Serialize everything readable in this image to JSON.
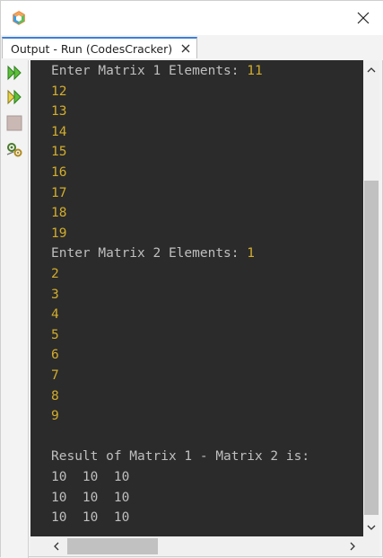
{
  "window": {
    "tab_title": "Output - Run (CodesCracker)"
  },
  "toolbar": {
    "icons": [
      "rerun-icon",
      "rerun-with-options-icon",
      "stop-icon",
      "settings-icon"
    ]
  },
  "console": {
    "lines": [
      {
        "prompt": "Enter Matrix 1 Elements: ",
        "input": "11"
      },
      {
        "prompt": "",
        "input": "12"
      },
      {
        "prompt": "",
        "input": "13"
      },
      {
        "prompt": "",
        "input": "14"
      },
      {
        "prompt": "",
        "input": "15"
      },
      {
        "prompt": "",
        "input": "16"
      },
      {
        "prompt": "",
        "input": "17"
      },
      {
        "prompt": "",
        "input": "18"
      },
      {
        "prompt": "",
        "input": "19"
      },
      {
        "prompt": "Enter Matrix 2 Elements: ",
        "input": "1"
      },
      {
        "prompt": "",
        "input": "2"
      },
      {
        "prompt": "",
        "input": "3"
      },
      {
        "prompt": "",
        "input": "4"
      },
      {
        "prompt": "",
        "input": "5"
      },
      {
        "prompt": "",
        "input": "6"
      },
      {
        "prompt": "",
        "input": "7"
      },
      {
        "prompt": "",
        "input": "8"
      },
      {
        "prompt": "",
        "input": "9"
      },
      {
        "prompt": "",
        "input": ""
      },
      {
        "prompt": "Result of Matrix 1 - Matrix 2 is:",
        "input": ""
      },
      {
        "prompt": "10  10  10",
        "input": ""
      },
      {
        "prompt": "10  10  10",
        "input": ""
      },
      {
        "prompt": "10  10  10",
        "input": ""
      }
    ]
  },
  "colors": {
    "console_bg": "#2b2b2b",
    "console_text": "#bfbfbf",
    "input_text": "#d2ad2c",
    "tab_accent": "#3d7ed8"
  }
}
